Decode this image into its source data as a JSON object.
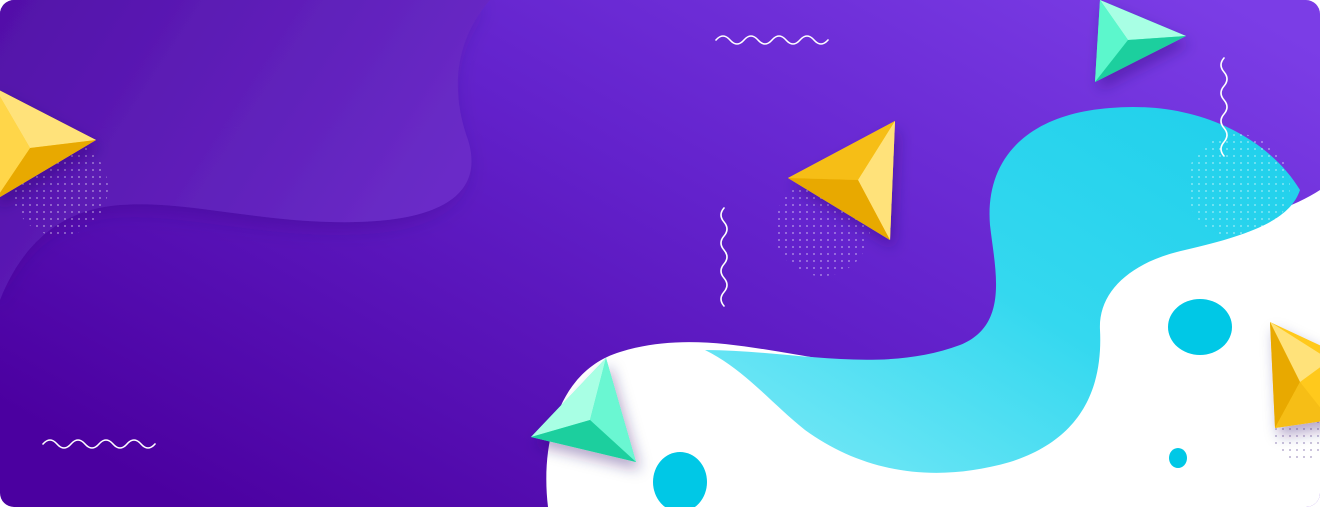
{
  "banner": {
    "colors": {
      "purple_dark": "#4B00A0",
      "purple_mid": "#5A14B8",
      "purple_light": "#7436DE",
      "cyan_light": "#63E3F2",
      "cyan": "#22D3EE",
      "cyan_spot": "#00C8E6",
      "white": "#FFFFFF",
      "yellow_light": "#FFE27A",
      "yellow": "#FFC91F",
      "yellow_dark": "#E8A900",
      "mint_light": "#A8FFE4",
      "mint": "#3DF2C0",
      "mint_dark": "#1FCF9E"
    },
    "icons": [
      "yellow-triangle-icon",
      "mint-triangle-icon",
      "wavy-line-icon",
      "dot-pattern-icon",
      "cyan-blob-icon"
    ]
  }
}
